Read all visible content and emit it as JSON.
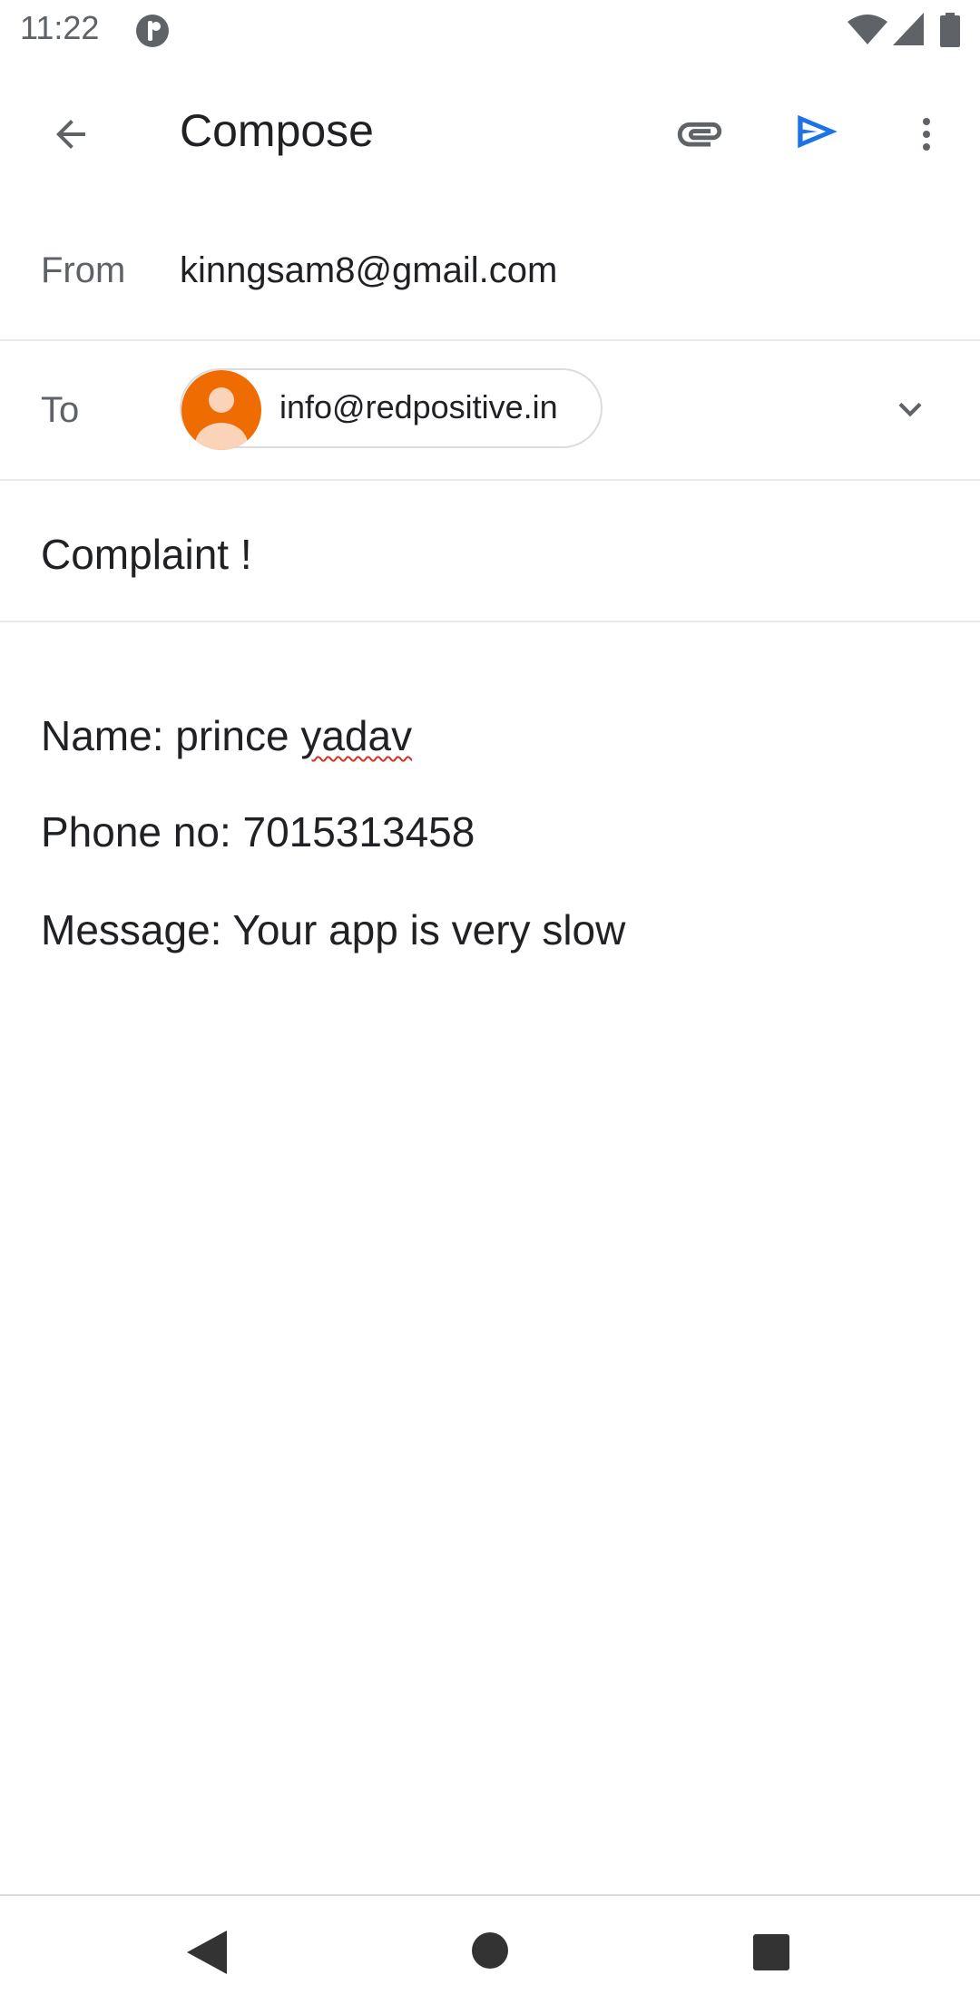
{
  "status_bar": {
    "time": "11:22",
    "icons": [
      "notification-app-icon",
      "wifi-icon",
      "signal-icon",
      "battery-icon"
    ]
  },
  "app_bar": {
    "title": "Compose",
    "icons": [
      "back-arrow-icon",
      "paperclip-icon",
      "send-icon",
      "more-vert-icon"
    ],
    "send_color": "#1a73e8"
  },
  "from": {
    "label": "From",
    "value": "kinngsam8@gmail.com"
  },
  "to": {
    "label": "To",
    "recipient": "info@redpositive.in",
    "avatar_color": "#ef6c00"
  },
  "subject": "Complaint !",
  "body": {
    "name_prefix": "Name: prince ",
    "name_misspelled": "yadav",
    "phone": "Phone no: 7015313458",
    "message": "Message: Your app is very slow"
  },
  "nav_bar": {
    "icons": [
      "nav-back-icon",
      "nav-home-icon",
      "nav-recents-icon"
    ]
  }
}
